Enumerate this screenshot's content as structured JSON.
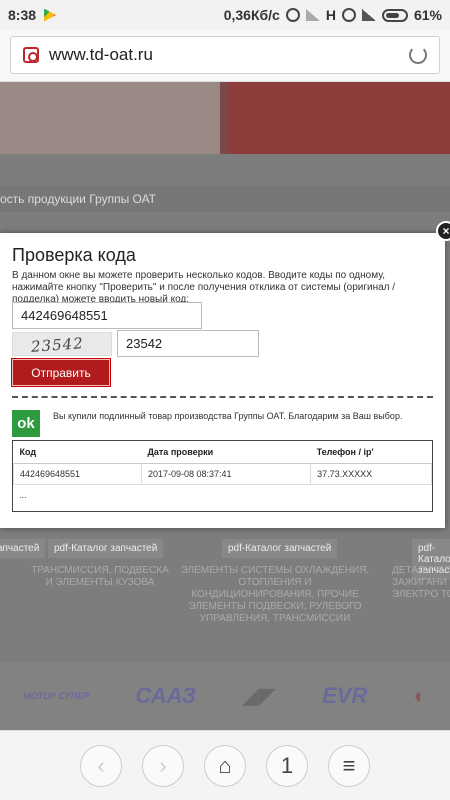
{
  "status_bar": {
    "time": "8:38",
    "speed": "0,36Кб/с",
    "network": "H",
    "battery": "61%"
  },
  "browser": {
    "url": "www.td-oat.ru"
  },
  "page": {
    "subnav_text": "ость продукции Группы ОАТ",
    "pdf_labels": [
      "pdf-Каталог запчастей",
      "pdf-Каталог запчастей",
      "pdf-Каталог запчастей"
    ],
    "categories": [
      "ТРАНСМИССИЯ, ПОДВЕСКА И ЭЛЕМЕНТЫ КУЗОВА",
      "ЭЛЕМЕНТЫ СИСТЕМЫ ОХЛАЖДЕНИЯ, ОТОПЛЕНИЯ И КОНДИЦИОНИРОВАНИЯ, ПРОЧИЕ ЭЛЕМЕНТЫ ПОДВЕСКИ, РУЛЕВОГО УПРАВЛЕНИЯ, ТРАНСМИССИИ",
      "ДЕТАЛИ КУЗ ЗАЖИГАНИ ЭЛЕКТРО ТОРМО"
    ],
    "brands": [
      "МОТОР СУПЕР",
      "СААЗ",
      "EVR"
    ]
  },
  "modal": {
    "title": "Проверка кода",
    "description": "В данном окне вы можете проверить несколько кодов. Вводите коды по одному, нажимайте кнопку \"Проверить\" и после получения отклика от системы (оригинал / подделка) можете вводить новый код:",
    "code_value": "442469648551",
    "captcha_image_text": "23542",
    "captcha_value": "23542",
    "submit_label": "Отправить",
    "ok_badge": "ok",
    "ok_message": "Вы купили подлинный товар производства Группы ОАТ. Благодарим за Ваш выбор.",
    "results": {
      "columns": [
        "Код",
        "Дата проверки",
        "Телефон / ip'"
      ],
      "rows": [
        [
          "442469648551",
          "2017-09-08 08:37:41",
          "37.73.XXXXX"
        ]
      ],
      "more": "..."
    }
  },
  "bottom_nav": {
    "tabs_count": "1"
  }
}
